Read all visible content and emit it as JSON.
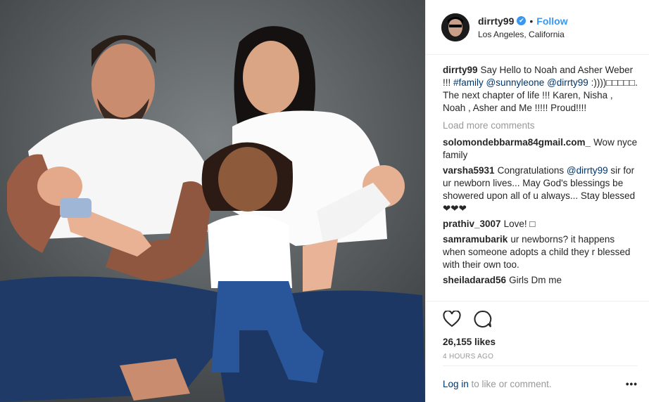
{
  "post": {
    "username": "dirrty99",
    "verified_symbol": "✔",
    "separator": "•",
    "follow_label": "Follow",
    "location": "Los Angeles, California"
  },
  "caption": {
    "username": "dirrty99",
    "text_1": "Say Hello to Noah and Asher Weber !!! ",
    "tag_1": "#family",
    "tag_2": "@sunnyleone",
    "tag_3": "@dirrty99",
    "text_2": ":))))□□□□□. The next chapter of life !!! Karen, Nisha , Noah , Asher and Me !!!!! Proud!!!!"
  },
  "load_more": "Load more comments",
  "comments": [
    {
      "user": "solomondebbarma84gmail.com_",
      "text": "Wow nyce family"
    },
    {
      "user": "varsha5931",
      "pre": "Congratulations ",
      "tag": "@dirrty99",
      "text": " sir for ur newborn lives... May God's blessings be showered upon all of u always... Stay blessed ❤❤❤"
    },
    {
      "user": "prathiv_3007",
      "text": "Love! □"
    },
    {
      "user": "samramubarik",
      "text": "ur newborns? it happens when someone adopts a child they r blessed with their own too."
    },
    {
      "user": "sheiladarad56",
      "text": "Girls Dm me"
    }
  ],
  "likes": "26,155 likes",
  "time_ago": "4 HOURS AGO",
  "footer": {
    "login_label": "Log in",
    "rest": " to like or comment.",
    "more": "•••"
  },
  "icons": {
    "like": "heart-icon",
    "comment": "comment-icon",
    "more": "more-options-icon"
  },
  "colors": {
    "link": "#3897f0",
    "tag": "#003569",
    "muted": "#999999"
  }
}
